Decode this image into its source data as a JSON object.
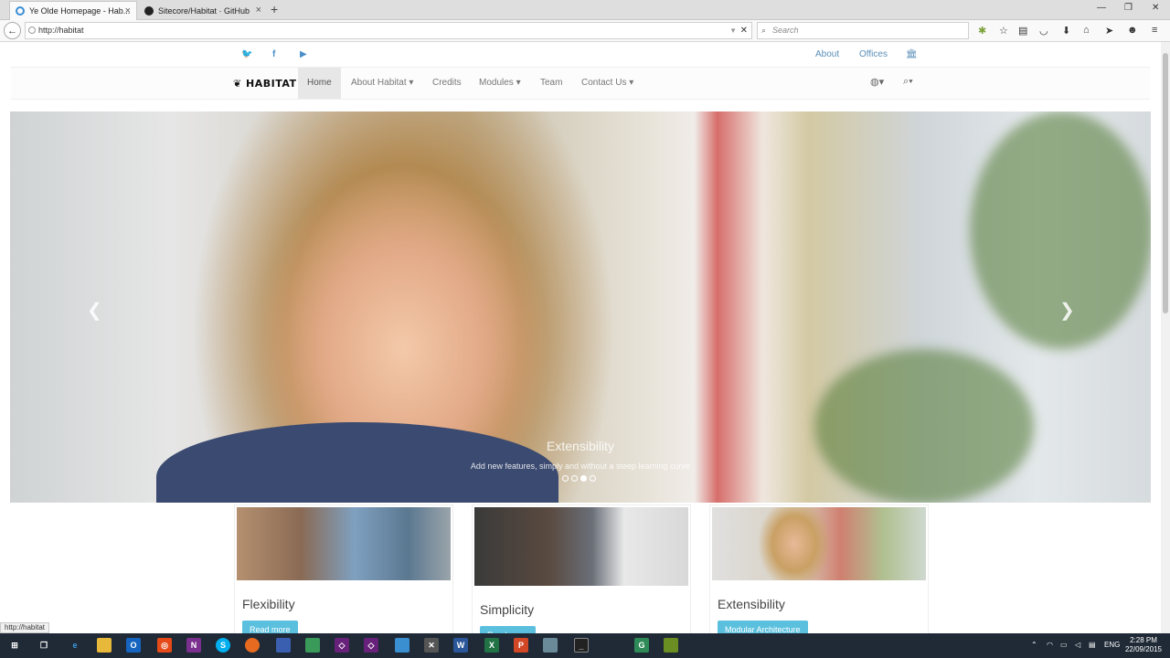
{
  "browser": {
    "tabs": [
      {
        "title": "Ye Olde Homepage - Hab...",
        "active": true
      },
      {
        "title": "Sitecore/Habitat · GitHub",
        "active": false
      }
    ],
    "url": "http://habitat",
    "search_placeholder": "Search",
    "status_url": "http://habitat"
  },
  "site": {
    "top_links": {
      "about": "About",
      "offices": "Offices"
    },
    "logo": "HABITAT",
    "nav": [
      {
        "label": "Home",
        "active": true
      },
      {
        "label": "About Habitat ▾"
      },
      {
        "label": "Credits"
      },
      {
        "label": "Modules ▾"
      },
      {
        "label": "Team"
      },
      {
        "label": "Contact Us ▾"
      }
    ],
    "hero": {
      "title": "Extensibility",
      "subtitle": "Add new features, simply and without a steep learning curve",
      "slide_count": 4,
      "active_slide": 3
    },
    "cards": [
      {
        "title": "Flexibility",
        "button": "Read more"
      },
      {
        "title": "Simplicity",
        "button": "Read more"
      },
      {
        "title": "Extensibility",
        "button": "Modular Architecture"
      }
    ]
  },
  "taskbar": {
    "lang": "ENG",
    "time": "2:28 PM",
    "date": "22/09/2015"
  },
  "colors": {
    "accent": "#5bc0de",
    "link": "#5a8fb8"
  }
}
